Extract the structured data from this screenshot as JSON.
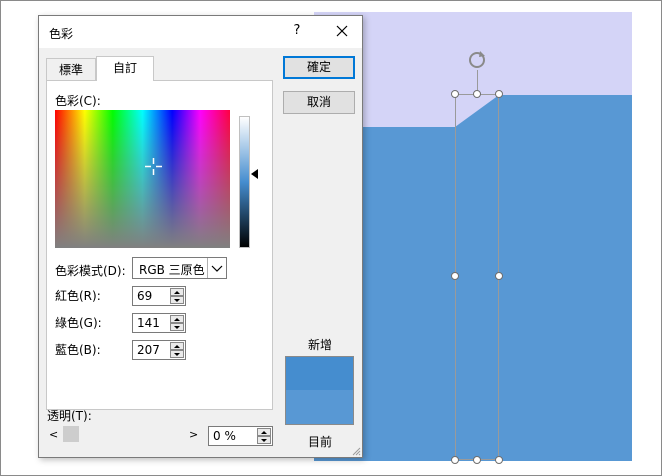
{
  "slide": {
    "top_color": "#d4d4f7",
    "shape_color": "#5898d4"
  },
  "dialog": {
    "title": "色彩",
    "help_label": "?",
    "tabs": [
      {
        "label": "標準",
        "active": false
      },
      {
        "label": "自訂",
        "active": true
      }
    ],
    "colors_label": "色彩(C):",
    "color_model_label": "色彩模式(D):",
    "color_model_value": "RGB 三原色",
    "red_label": "紅色(R):",
    "green_label": "綠色(G):",
    "blue_label": "藍色(B):",
    "red_value": "69",
    "green_value": "141",
    "blue_value": "207",
    "ok_label": "確定",
    "cancel_label": "取消",
    "new_label": "新增",
    "current_label": "目前",
    "new_color": "#458dcf",
    "current_color": "#5898d4",
    "transparency_label": "透明(T):",
    "transparency_value": "0 %",
    "transparency_fraction": 0
  }
}
